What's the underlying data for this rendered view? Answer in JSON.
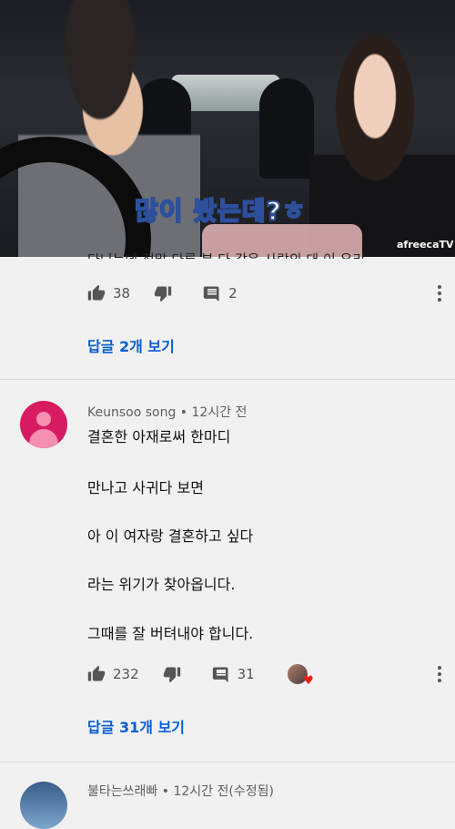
{
  "video": {
    "caption": "많이 봤는데?ㅎ",
    "brand": "afreecaTV"
  },
  "comment1": {
    "partial_text": "다니는데 정말 다른 분 다 같은 사람의 대 이 우리",
    "likes": "38",
    "replies_count": "2",
    "view_replies": "답글 2개 보기"
  },
  "comment2": {
    "author": "Keunsoo song",
    "time": "12시간 전",
    "lines": [
      "결혼한 아재로써 한마디",
      "만나고 사귀다 보면",
      "아 이 여자랑 결혼하고 싶다",
      "라는 위기가 찾아옵니다.",
      "그때를 잘 버텨내야 합니다."
    ],
    "likes": "232",
    "replies_count": "31",
    "view_replies": "답글 31개 보기"
  },
  "comment3": {
    "author": "불타는쓰래빠",
    "time": "12시간 전(수정됨)"
  },
  "colors": {
    "link": "#065fd4",
    "background": "#f1f1f1",
    "avatar_pink": "#d81b60"
  }
}
